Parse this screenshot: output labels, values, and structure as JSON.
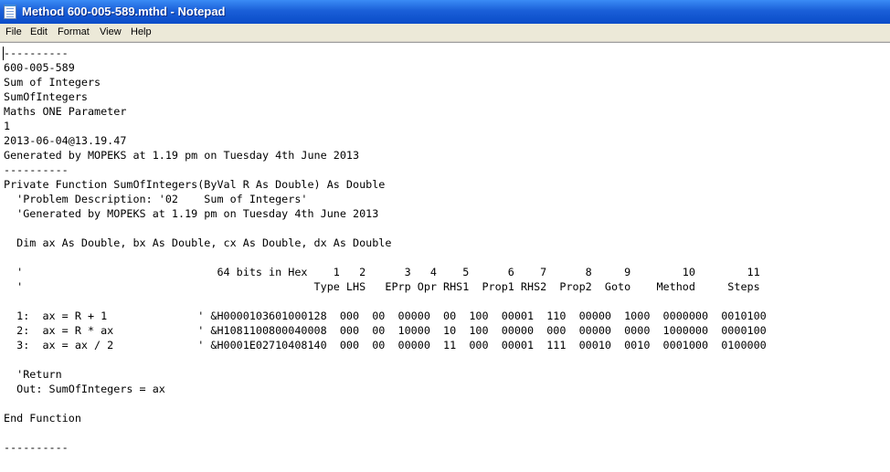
{
  "window": {
    "title": "Method 600-005-589.mthd - Notepad",
    "icon": "notepad-icon"
  },
  "menu": {
    "file": "File",
    "edit": "Edit",
    "format": "Format",
    "view": "View",
    "help": "Help"
  },
  "document": {
    "lines": [
      "----------",
      "600-005-589",
      "Sum of Integers",
      "SumOfIntegers",
      "Maths ONE Parameter",
      "1",
      "2013-06-04@13.19.47",
      "Generated by MOPEKS at 1.19 pm on Tuesday 4th June 2013",
      "----------",
      "Private Function SumOfIntegers(ByVal R As Double) As Double",
      "  'Problem Description: '02    Sum of Integers'",
      "  'Generated by MOPEKS at 1.19 pm on Tuesday 4th June 2013",
      "",
      "  Dim ax As Double, bx As Double, cx As Double, dx As Double",
      "",
      "  '                              64 bits in Hex    1   2      3   4    5      6    7      8     9        10        11",
      "  '                                             Type LHS   EPrp Opr RHS1  Prop1 RHS2  Prop2  Goto    Method     Steps",
      "",
      "  1:  ax = R + 1              ' &H0000103601000128  000  00  00000  00  100  00001  110  00000  1000  0000000  0010100",
      "  2:  ax = R * ax             ' &H1081100800040008  000  00  10000  10  100  00000  000  00000  0000  1000000  0000100",
      "  3:  ax = ax / 2             ' &H0001E02710408140  000  00  00000  11  000  00001  111  00010  0010  0001000  0100000",
      "",
      "  'Return",
      "  Out: SumOfIntegers = ax",
      "",
      "End Function",
      "",
      "----------"
    ]
  }
}
